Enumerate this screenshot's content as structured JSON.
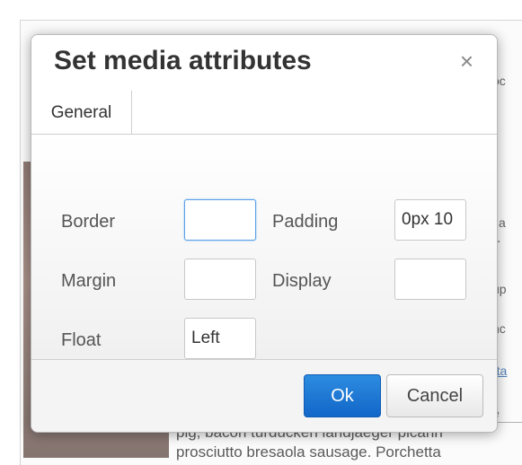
{
  "dialog": {
    "title": "Set media attributes",
    "close_glyph": "×",
    "tabs": [
      {
        "label": "General",
        "active": true
      }
    ],
    "fields": {
      "border": {
        "label": "Border",
        "value": ""
      },
      "padding": {
        "label": "Padding",
        "value": "0px 10"
      },
      "margin": {
        "label": "Margin",
        "value": ""
      },
      "display": {
        "label": "Display",
        "value": ""
      },
      "float": {
        "label": "Float",
        "value": "Left"
      }
    },
    "ok_label": "Ok",
    "cancel_label": "Cancel"
  },
  "background": {
    "right_snippets": [
      "oc",
      "i a",
      "T",
      "up",
      "nc",
      "rta",
      "e"
    ],
    "bottom_lines": [
      "pig, bacon turducken landjaeger picanh",
      "prosciutto bresaola sausage. Porchetta"
    ]
  },
  "colors": {
    "primary_button": "#1a73d1",
    "focus_border": "#5aa0e8"
  }
}
